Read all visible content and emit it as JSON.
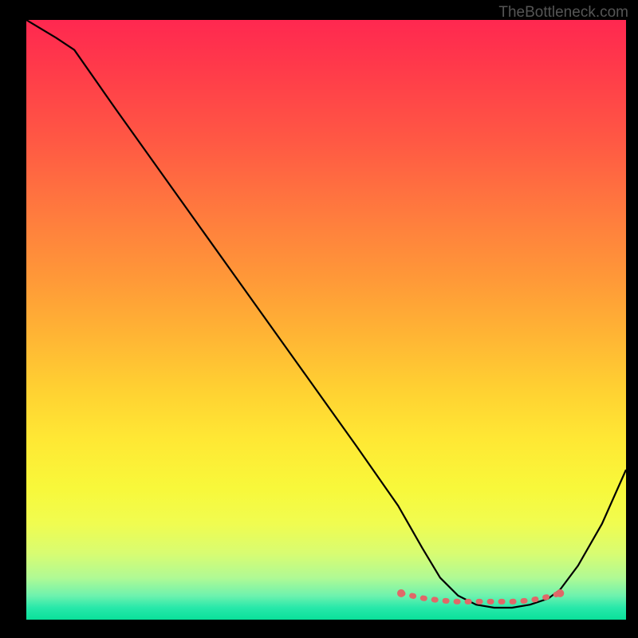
{
  "watermark": "TheBottleneck.com",
  "chart_data": {
    "type": "line",
    "title": "",
    "xlabel": "",
    "ylabel": "",
    "xlim": [
      0,
      100
    ],
    "ylim": [
      0,
      100
    ],
    "series": [
      {
        "name": "bottleneck-curve",
        "x": [
          0,
          5,
          8,
          15,
          25,
          35,
          45,
          55,
          62,
          66,
          69,
          72,
          75,
          78,
          81,
          84,
          87,
          89,
          92,
          96,
          100
        ],
        "values": [
          100,
          97,
          95,
          85,
          71,
          57,
          43,
          29,
          19,
          12,
          7,
          4,
          2.5,
          2,
          2,
          2.5,
          3.5,
          5,
          9,
          16,
          25
        ]
      }
    ],
    "highlight_range": {
      "name": "optimal-zone",
      "x": [
        62.5,
        66,
        69,
        72,
        75,
        78,
        81,
        84,
        87,
        89
      ],
      "values": [
        4.4,
        3.6,
        3.2,
        3.0,
        3.0,
        3.0,
        3.0,
        3.2,
        3.8,
        4.4
      ]
    }
  }
}
